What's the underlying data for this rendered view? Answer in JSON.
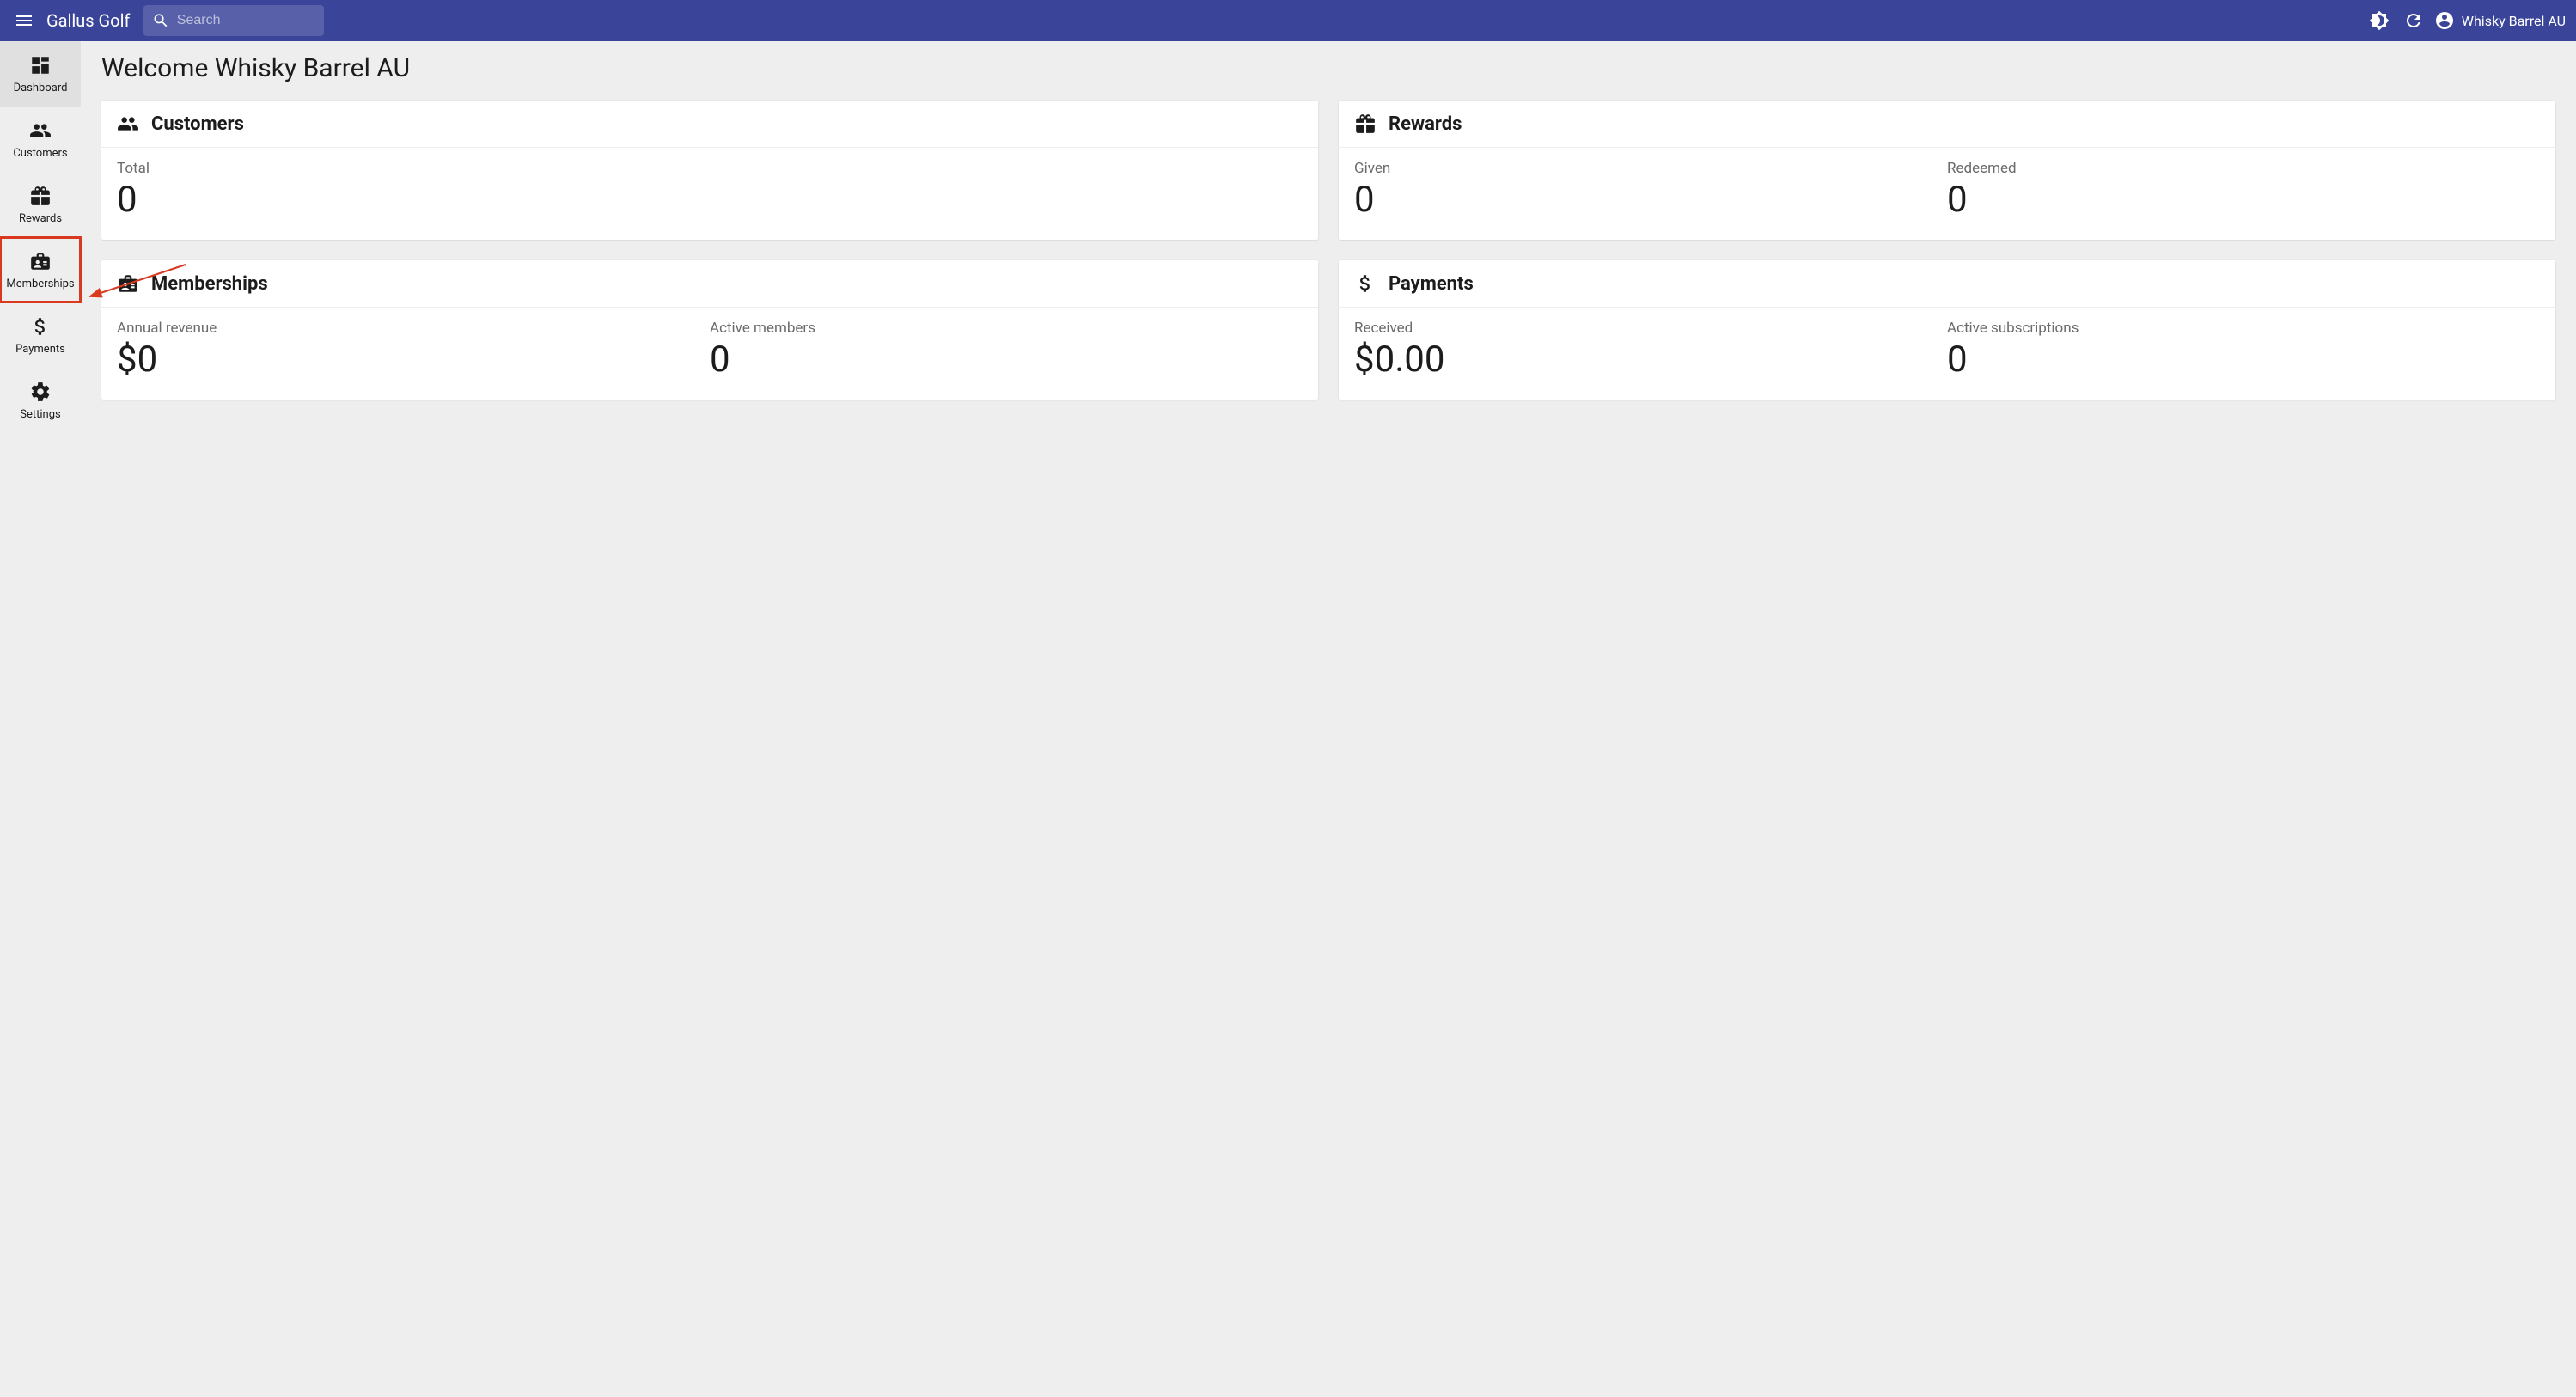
{
  "header": {
    "app_title": "Gallus Golf",
    "search_placeholder": "Search",
    "user_name": "Whisky Barrel AU"
  },
  "sidebar": {
    "items": [
      {
        "label": "Dashboard"
      },
      {
        "label": "Customers"
      },
      {
        "label": "Rewards"
      },
      {
        "label": "Memberships"
      },
      {
        "label": "Payments"
      },
      {
        "label": "Settings"
      }
    ]
  },
  "main": {
    "welcome": "Welcome Whisky Barrel AU"
  },
  "cards": {
    "customers": {
      "title": "Customers",
      "total_label": "Total",
      "total_value": "0"
    },
    "rewards": {
      "title": "Rewards",
      "given_label": "Given",
      "given_value": "0",
      "redeemed_label": "Redeemed",
      "redeemed_value": "0"
    },
    "memberships": {
      "title": "Memberships",
      "revenue_label": "Annual revenue",
      "revenue_value": "$0",
      "active_label": "Active members",
      "active_value": "0"
    },
    "payments": {
      "title": "Payments",
      "received_label": "Received",
      "received_value": "$0.00",
      "subs_label": "Active subscriptions",
      "subs_value": "0"
    }
  }
}
